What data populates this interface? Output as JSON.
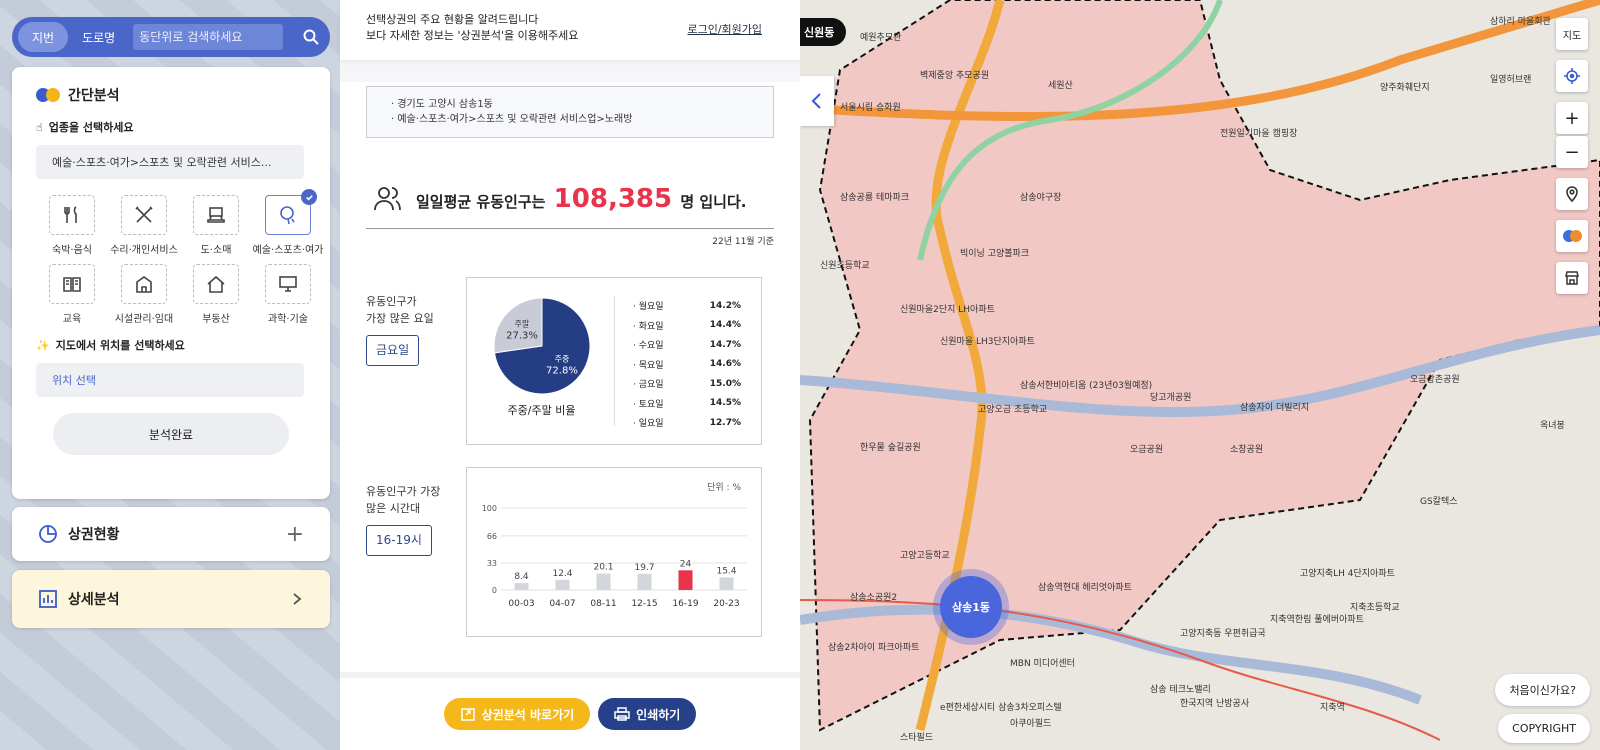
{
  "search": {
    "tab_jibun": "지번",
    "tab_road": "도로명",
    "placeholder": "동단위로 검색하세요"
  },
  "simple": {
    "title": "간단분석",
    "step1_label": "업종을 선택하세요",
    "selected_category": "예술·스포츠·여가>스포츠 및 오락관련 서비스...",
    "categories": [
      {
        "label": "숙박·음식",
        "icon": "utensils-icon"
      },
      {
        "label": "수리·개인서비스",
        "icon": "tools-icon"
      },
      {
        "label": "도·소매",
        "icon": "register-icon"
      },
      {
        "label": "예술·스포츠·여가",
        "icon": "pingpong-icon"
      },
      {
        "label": "교육",
        "icon": "book-icon"
      },
      {
        "label": "시설관리·임대",
        "icon": "building-icon"
      },
      {
        "label": "부동산",
        "icon": "house-icon"
      },
      {
        "label": "과학·기술",
        "icon": "computer-icon"
      }
    ],
    "step2_label": "지도에서 위치를 선택하세요",
    "location_btn": "위치 선택",
    "done_btn": "분석완료"
  },
  "market_status": {
    "title": "상권현황"
  },
  "detail": {
    "title": "상세분석"
  },
  "mid": {
    "head_line1": "선택상권의 주요 현황을 알려드립니다",
    "head_line2": "보다 자세한 정보는 '상권분석'을 이용해주세요",
    "login": "로그인/회원가입",
    "addr1": "경기도 고양시 삼송1동",
    "addr2": "예술·스포츠·여가>스포츠 및 오락관련 서비스업>노래방",
    "headline_pre": "일일평균 유동인구는",
    "headline_num": "108,385",
    "headline_post": "명 입니다.",
    "basis": "22년 11월 기준",
    "dow_label_1": "유동인구가",
    "dow_label_2": "가장 많은 요일",
    "dow_btn": "금요일",
    "time_label_1": "유동인구가 가장",
    "time_label_2": "많은 시간대",
    "time_btn": "16-19시",
    "unit": "단위 : %",
    "btn_analysis": "상권분석 바로가기",
    "btn_print": "인쇄하기"
  },
  "chart_data": [
    {
      "type": "pie",
      "title": "주중/주말 비율",
      "slices": [
        {
          "label": "주중",
          "value": 72.8,
          "color": "#243d84"
        },
        {
          "label": "주말",
          "value": 27.3,
          "color": "#c9cbd6"
        }
      ]
    },
    {
      "type": "table",
      "rows": [
        [
          "월요일",
          "14.2%"
        ],
        [
          "화요일",
          "14.4%"
        ],
        [
          "수요일",
          "14.7%"
        ],
        [
          "목요일",
          "14.6%"
        ],
        [
          "금요일",
          "15.0%"
        ],
        [
          "토요일",
          "14.5%"
        ],
        [
          "일요일",
          "12.7%"
        ]
      ]
    },
    {
      "type": "bar",
      "categories": [
        "00-03",
        "04-07",
        "08-11",
        "12-15",
        "16-19",
        "20-23"
      ],
      "values": [
        8.4,
        12.4,
        20.1,
        19.7,
        24,
        15.4
      ],
      "ylim": [
        0,
        100
      ],
      "yticks": [
        0,
        33,
        66,
        100
      ],
      "highlight": "16-19",
      "color": "#d4d6de",
      "highlight_color": "#e8334a"
    }
  ],
  "map": {
    "badge": "신원동",
    "marker": "삼송1동",
    "ctl_map": "지도",
    "first_visit": "처음이신가요?",
    "copyright": "COPYRIGHT",
    "labels": [
      "예원추모관",
      "벽제중앙 추모공원",
      "세원산",
      "서울시립 승화원",
      "삼송공룡 테마파크",
      "빅이닝 고양볼파크",
      "신원마을2단지 LH아파트",
      "신원초등학교",
      "신원마을 LH3단지아파트",
      "삼송서한비아티움 (23년03월예정)",
      "고양오금 초등학교",
      "당고개공원",
      "삼송자이 더빌리지",
      "오금공원",
      "소창공원",
      "오금상촌공원",
      "한우물 숲길공원",
      "고양고등학교",
      "삼송역현대 헤리엇아파트",
      "삼송소공원2",
      "삼송2차아이 파크아파트",
      "MBN 미디어센터",
      "고양지축동 우편취급국",
      "지축역한림 풀에버아파트",
      "지축초등학교",
      "GS칼텍스",
      "삼송 테크노밸리",
      "e편한세상시티 삼송3차오피스텔",
      "양주화훼단지",
      "일영허브랜",
      "삼하리 마을회관",
      "옥녀봉",
      "전원일기마을 캠핑장",
      "삼송야구장",
      "고양지축LH 4단지아파트",
      "한국지역 난방공사",
      "아쿠아필드",
      "스타필드",
      "지축역"
    ]
  }
}
